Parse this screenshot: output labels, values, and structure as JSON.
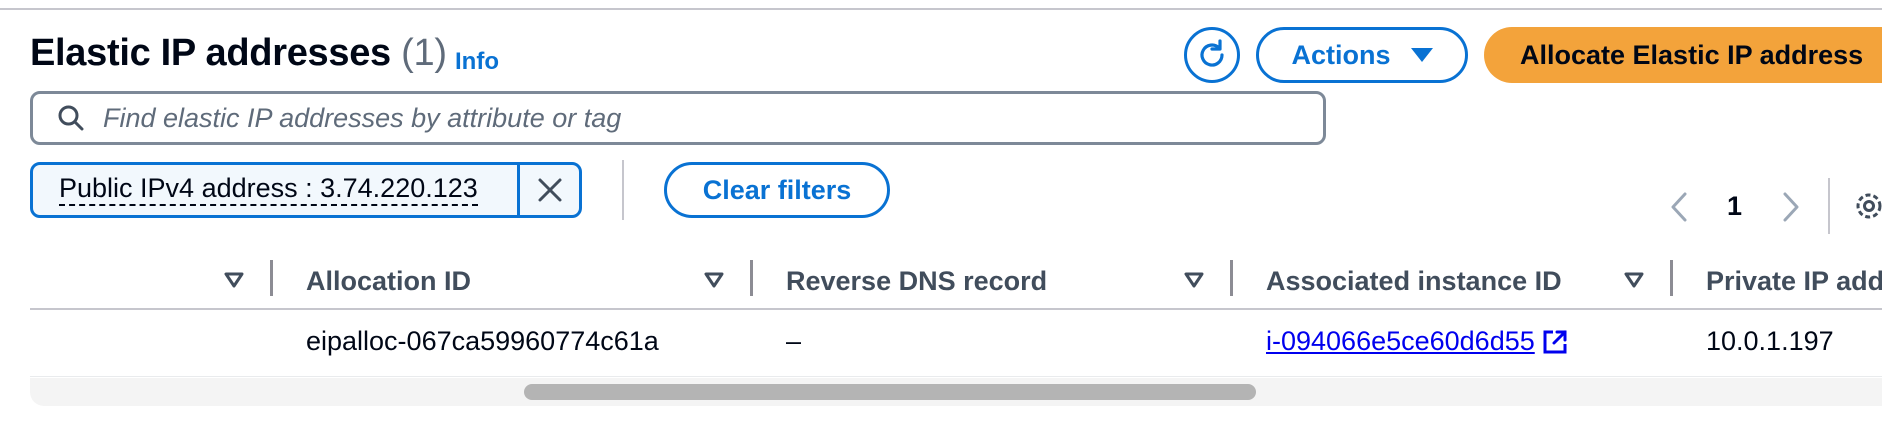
{
  "header": {
    "title": "Elastic IP addresses",
    "count": "(1)",
    "info_label": "Info",
    "actions_label": "Actions",
    "allocate_label": "Allocate Elastic IP address"
  },
  "search": {
    "placeholder": "Find elastic IP addresses by attribute or tag"
  },
  "filter": {
    "token_label": "Public IPv4 address : 3.74.220.123",
    "clear_label": "Clear filters"
  },
  "pagination": {
    "current_page": "1"
  },
  "table": {
    "columns": [
      "Allocation ID",
      "Reverse DNS record",
      "Associated instance ID",
      "Private IP add"
    ],
    "rows": [
      {
        "allocation_id": "eipalloc-067ca59960774c61a",
        "reverse_dns": "–",
        "instance_id": "i-094066e5ce60d6d55",
        "private_ip": "10.0.1.197"
      }
    ]
  },
  "colors": {
    "accent": "#0972d3",
    "primary_button": "#f3a33b",
    "link": "#0000ee"
  },
  "icons": [
    "refresh-icon",
    "caret-down-icon",
    "search-icon",
    "close-icon",
    "chevron-left-icon",
    "chevron-right-icon",
    "settings-icon",
    "sort-icon",
    "external-link-icon"
  ]
}
